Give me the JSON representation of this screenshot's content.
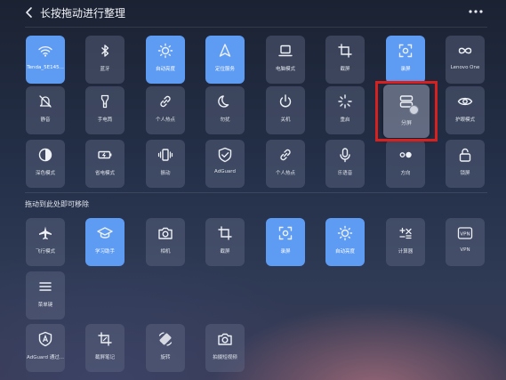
{
  "header": {
    "title": "长按拖动进行整理"
  },
  "section2": {
    "label": "拖动到此处即可移除"
  },
  "colors": {
    "active": "#5e9cf4",
    "highlight": "#d8201f"
  },
  "top_rows": [
    [
      {
        "label": "Tenda_5E145...",
        "icon": "wifi-icon",
        "active": true
      },
      {
        "label": "蓝牙",
        "icon": "bluetooth-icon",
        "active": false
      },
      {
        "label": "自动亮度",
        "icon": "brightness-icon",
        "active": true
      },
      {
        "label": "定位服务",
        "icon": "location-icon",
        "active": true
      },
      {
        "label": "电脑模式",
        "icon": "laptop-icon",
        "active": false
      },
      {
        "label": "截屏",
        "icon": "crop-icon",
        "active": false
      },
      {
        "label": "录屏",
        "icon": "screen-record-icon",
        "active": true
      },
      {
        "label": "Lenovo One",
        "icon": "infinity-icon",
        "active": false
      }
    ],
    [
      {
        "label": "静音",
        "icon": "mute-bell-icon",
        "active": false
      },
      {
        "label": "手电筒",
        "icon": "flashlight-icon",
        "active": false
      },
      {
        "label": "个人热点",
        "icon": "link-icon",
        "active": false
      },
      {
        "label": "勿扰",
        "icon": "moon-icon",
        "active": false
      },
      {
        "label": "关机",
        "icon": "power-icon",
        "active": false
      },
      {
        "label": "重启",
        "icon": "restart-icon",
        "active": false
      },
      {
        "label": "分屏",
        "icon": "split-screen-icon",
        "active": false
      },
      {
        "label": "护眼模式",
        "icon": "eye-icon",
        "active": false
      }
    ],
    [
      {
        "label": "深色模式",
        "icon": "contrast-icon",
        "active": false
      },
      {
        "label": "省电模式",
        "icon": "battery-icon",
        "active": false
      },
      {
        "label": "振动",
        "icon": "vibrate-icon",
        "active": false
      },
      {
        "label": "AdGuard",
        "icon": "shield-check-icon",
        "active": false
      },
      {
        "label": "个人热点",
        "icon": "link-icon",
        "active": false
      },
      {
        "label": "乐语音",
        "icon": "microphone-icon",
        "active": false
      },
      {
        "label": "方向",
        "icon": "toggle-icon",
        "active": false
      },
      {
        "label": "锁屏",
        "icon": "lock-icon",
        "active": false
      }
    ]
  ],
  "bottom_rows": [
    [
      {
        "label": "飞行模式",
        "icon": "airplane-icon",
        "active": false
      },
      {
        "label": "学习助手",
        "icon": "graduation-cap-icon",
        "active": true
      },
      {
        "label": "相机",
        "icon": "camera-icon",
        "active": false
      },
      {
        "label": "截屏",
        "icon": "crop-icon",
        "active": false
      },
      {
        "label": "录屏",
        "icon": "screen-record-icon",
        "active": true
      },
      {
        "label": "自动亮度",
        "icon": "brightness-icon",
        "active": true
      },
      {
        "label": "计算器",
        "icon": "calculator-icon",
        "active": false
      },
      {
        "label": "VPN",
        "icon": "vpn-icon",
        "active": false
      }
    ],
    [
      {
        "label": "菜单键",
        "icon": "menu-icon",
        "active": false
      }
    ],
    [
      {
        "label": "AdGuard 通过...",
        "icon": "shield-a-icon",
        "active": false
      },
      {
        "label": "截屏笔记",
        "icon": "screenshot-note-icon",
        "active": false
      },
      {
        "label": "旋转",
        "icon": "rotate-icon",
        "active": false
      },
      {
        "label": "拍摄短视频",
        "icon": "camera-icon",
        "active": false
      }
    ]
  ]
}
